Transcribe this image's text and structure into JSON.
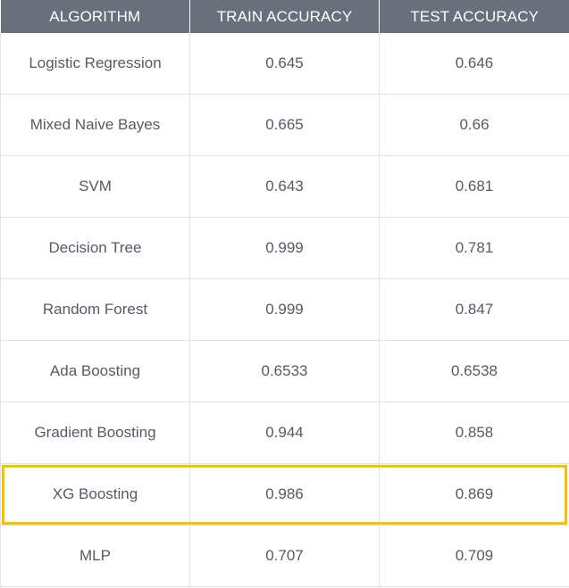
{
  "table": {
    "headers": [
      "ALGORITHM",
      "TRAIN ACCURACY",
      "TEST ACCURACY"
    ],
    "rows": [
      [
        "Logistic Regression",
        "0.645",
        "0.646"
      ],
      [
        "Mixed Naive Bayes",
        "0.665",
        "0.66"
      ],
      [
        "SVM",
        "0.643",
        "0.681"
      ],
      [
        "Decision Tree",
        "0.999",
        "0.781"
      ],
      [
        "Random Forest",
        "0.999",
        "0.847"
      ],
      [
        "Ada Boosting",
        "0.6533",
        "0.6538"
      ],
      [
        "Gradient Boosting",
        "0.944",
        "0.858"
      ],
      [
        "XG Boosting",
        "0.986",
        "0.869"
      ],
      [
        "MLP",
        "0.707",
        "0.709"
      ]
    ],
    "highlighted_row": 7
  },
  "colors": {
    "header_bg": "#6a6f7c",
    "header_text": "#ffffff",
    "cell_text": "#555a66",
    "grid": "#e2e2e2",
    "highlight": "#f6c200"
  }
}
